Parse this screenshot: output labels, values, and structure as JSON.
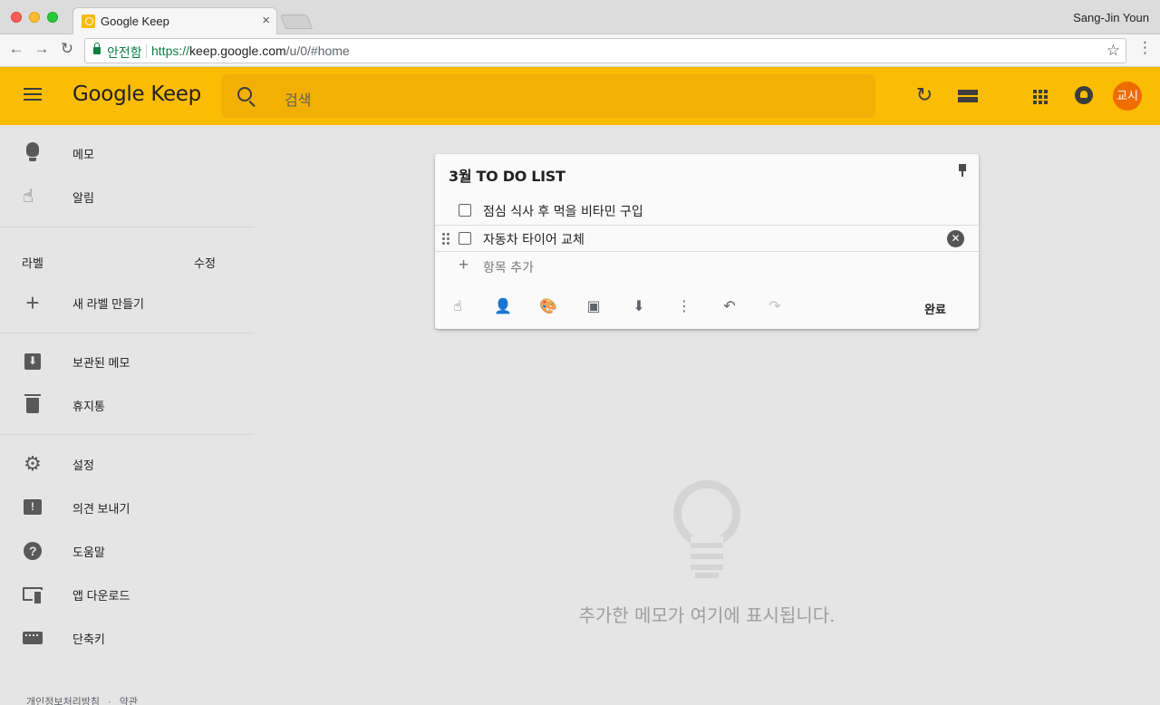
{
  "browser": {
    "tab_title": "Google Keep",
    "tab_close": "×",
    "profile_name": "Sang-Jin Youn",
    "secure_label": "안전함",
    "url_scheme": "https://",
    "url_host": "keep.google.com",
    "url_path": "/u/0/#home",
    "back": "←",
    "forward": "→",
    "reload": "↻",
    "star": "☆",
    "menu": "⋮"
  },
  "header": {
    "brand": "Google Keep",
    "search_placeholder": "검색",
    "avatar_text": "교시",
    "refresh_glyph": "↻"
  },
  "sidebar": {
    "notes": "메모",
    "reminders": "알림",
    "labels_title": "라벨",
    "labels_edit": "수정",
    "new_label": "새 라벨 만들기",
    "archive": "보관된 메모",
    "trash": "휴지통",
    "settings": "설정",
    "feedback": "의견 보내기",
    "help": "도움말",
    "app_download": "앱 다운로드",
    "shortcuts": "단축키",
    "footer_privacy": "개인정보처리방침",
    "footer_sep": "·",
    "footer_terms": "약관"
  },
  "note": {
    "title": "3월 TO DO LIST",
    "items": [
      {
        "text": "점심 식사 후 먹을 비타민 구입",
        "checked": false
      },
      {
        "text": "자동차 타이어 교체",
        "checked": false
      }
    ],
    "add_item_placeholder": "항목 추가",
    "add_glyph": "+",
    "remove_glyph": "✕",
    "done_label": "완료",
    "tools": [
      {
        "icon": "reminder-icon",
        "glyph": "☝"
      },
      {
        "icon": "collaborator-icon",
        "glyph": "👤"
      },
      {
        "icon": "palette-icon",
        "glyph": "🎨"
      },
      {
        "icon": "image-icon",
        "glyph": "▣"
      },
      {
        "icon": "archive-icon",
        "glyph": "⬇"
      },
      {
        "icon": "more-icon",
        "glyph": "⋮"
      },
      {
        "icon": "undo-icon",
        "glyph": "↶"
      },
      {
        "icon": "redo-icon",
        "glyph": "↷"
      }
    ]
  },
  "empty_state": {
    "message": "추가한 메모가 여기에 표시됩니다."
  }
}
